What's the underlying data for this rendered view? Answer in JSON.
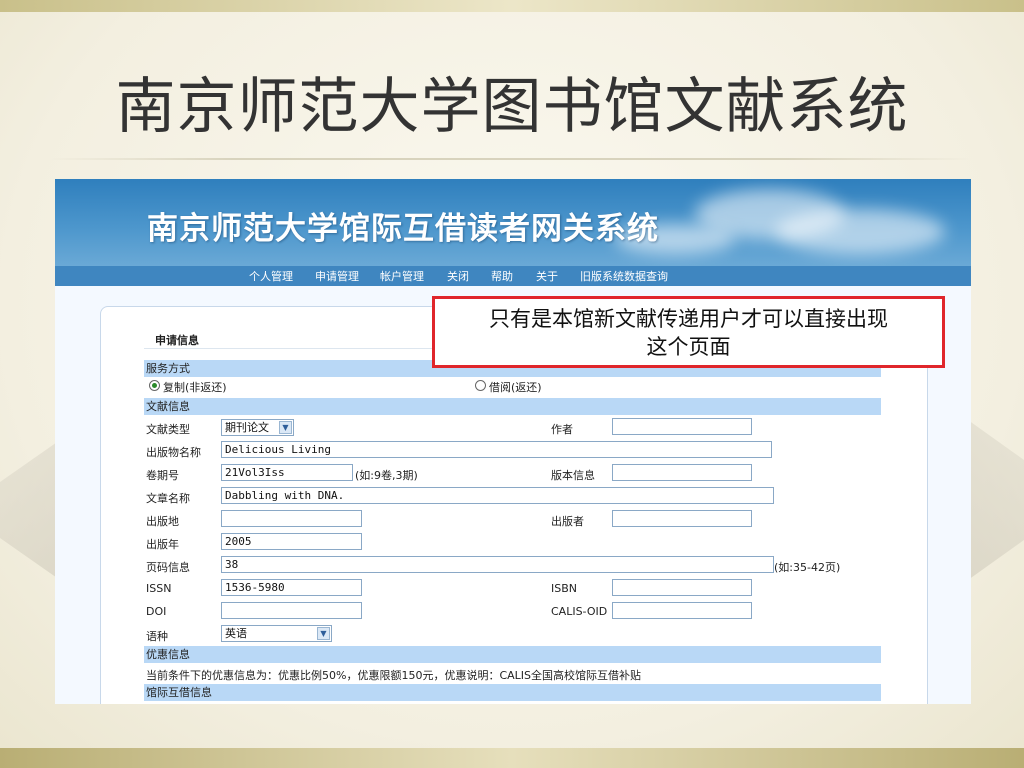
{
  "slide": {
    "title": "南京师范大学图书馆文献系统"
  },
  "banner": {
    "title": "南京师范大学馆际互借读者网关系统"
  },
  "nav": {
    "items": [
      "个人管理",
      "申请管理",
      "帐户管理",
      "关闭",
      "帮助",
      "关于",
      "旧版系统数据查询"
    ]
  },
  "callout": {
    "line1": "只有是本馆新文献传递用户才可以直接出现",
    "line2": "这个页面"
  },
  "form": {
    "heading": "申请信息",
    "service_section": "服务方式",
    "service_options": [
      "复制(非返还)",
      "借阅(返还)"
    ],
    "service_selected": "复制(非返还)",
    "doc_section": "文献信息",
    "labels": {
      "doc_type": "文献类型",
      "author": "作者",
      "publication": "出版物名称",
      "volume": "卷期号",
      "edition": "版本信息",
      "article": "文章名称",
      "place": "出版地",
      "publisher": "出版者",
      "year": "出版年",
      "pages": "页码信息",
      "issn": "ISSN",
      "isbn": "ISBN",
      "doi": "DOI",
      "calis_oid": "CALIS-OID",
      "language": "语种"
    },
    "values": {
      "doc_type": "期刊论文",
      "author": "",
      "publication": "Delicious Living",
      "volume": "21Vol3Iss",
      "edition": "",
      "article": "Dabbling with DNA.",
      "place": "",
      "publisher": "",
      "year": "2005",
      "pages": "38",
      "issn": "1536-5980",
      "isbn": "",
      "doi": "",
      "calis_oid": "",
      "language": "英语"
    },
    "hints": {
      "volume": "(如:9卷,3期)",
      "pages": "(如:35-42页)"
    },
    "discount_section": "优惠信息",
    "discount_text": "当前条件下的优惠信息为：优惠比例50%，优惠限额150元，优惠说明：CALIS全国高校馆际互借补贴",
    "ill_section": "馆际互借信息"
  },
  "colors": {
    "banner": "#3f86c0",
    "section": "#b9d8f6",
    "callout_border": "#e0262b"
  }
}
